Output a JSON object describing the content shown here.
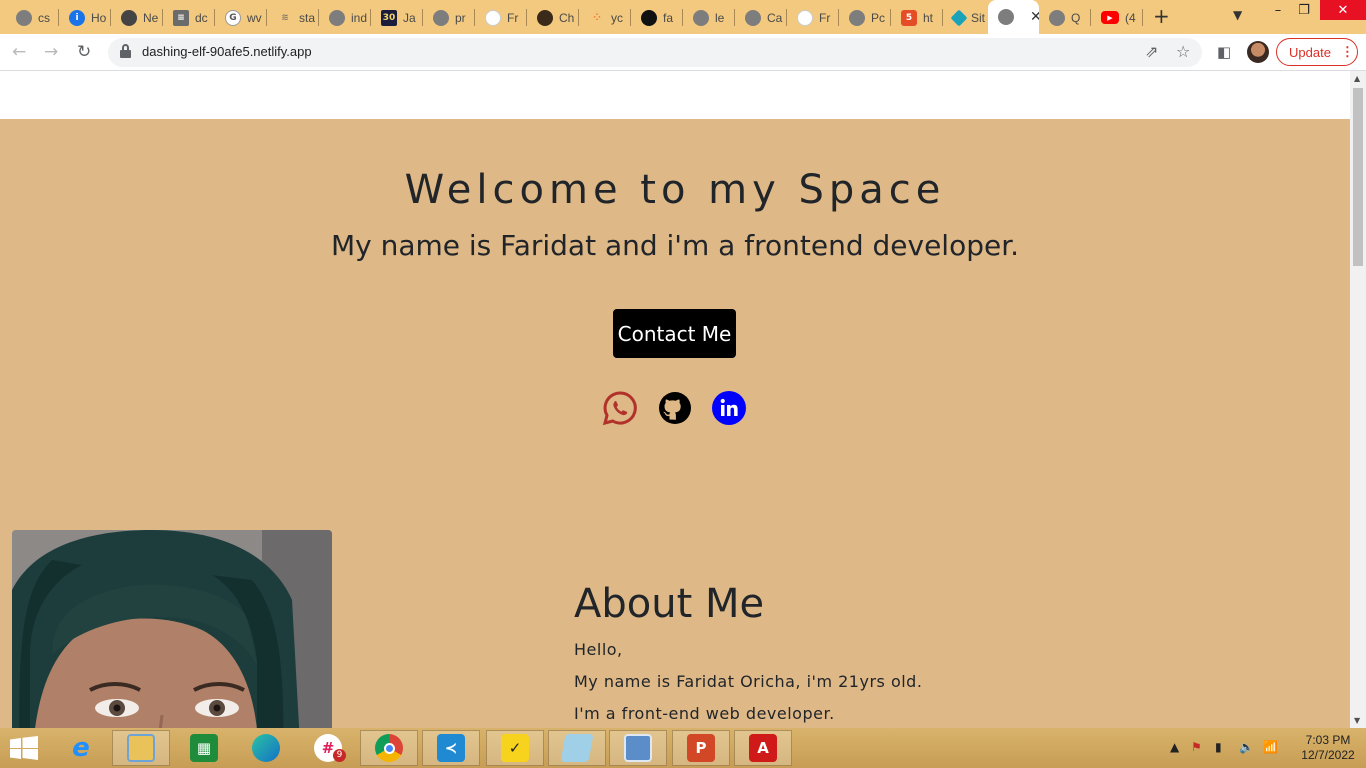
{
  "browser": {
    "tabs": [
      {
        "label": "cs",
        "icon": "globe-icon"
      },
      {
        "label": "Ho",
        "icon": "info-icon"
      },
      {
        "label": "Ne",
        "icon": "globe-icon"
      },
      {
        "label": "dc",
        "icon": "document-icon"
      },
      {
        "label": "wv",
        "icon": "google-icon"
      },
      {
        "label": "sta",
        "icon": "stack-icon"
      },
      {
        "label": "ind",
        "icon": "globe-icon"
      },
      {
        "label": "Ja",
        "icon": "js30-icon"
      },
      {
        "label": "pr",
        "icon": "globe-icon"
      },
      {
        "label": "Fr",
        "icon": "freecodecamp-icon"
      },
      {
        "label": "Ch",
        "icon": "avatar-icon"
      },
      {
        "label": "yc",
        "icon": "ycombinator-icon"
      },
      {
        "label": "fa",
        "icon": "github-icon"
      },
      {
        "label": "le",
        "icon": "globe-icon"
      },
      {
        "label": "Ca",
        "icon": "globe-icon"
      },
      {
        "label": "Fr",
        "icon": "freecodecamp-icon"
      },
      {
        "label": "Pc",
        "icon": "globe-icon"
      },
      {
        "label": "ht",
        "icon": "html5-icon"
      },
      {
        "label": "Sit",
        "icon": "diamond-icon"
      },
      {
        "label": "",
        "icon": "globe-icon",
        "active": true
      },
      {
        "label": "Q",
        "icon": "globe-icon"
      },
      {
        "label": "(4",
        "icon": "youtube-icon"
      }
    ],
    "url": "dashing-elf-90afe5.netlify.app",
    "update_label": "Update"
  },
  "page": {
    "hero_title": "Welcome to my Space",
    "hero_subtitle": "My name is Faridat and i'm a frontend developer.",
    "contact_button": "Contact Me",
    "socials": [
      "whatsapp-icon",
      "github-icon",
      "linkedin-icon"
    ],
    "about": {
      "title": "About Me",
      "lines": [
        "Hello,",
        "My name is Faridat Oricha, i'm 21yrs old.",
        "I'm a front-end web developer."
      ]
    }
  },
  "taskbar": {
    "apps": [
      "internet-explorer-icon",
      "file-explorer-icon",
      "store-icon",
      "edge-icon",
      "slack-icon",
      "chrome-icon",
      "vscode-icon",
      "sticky-notes-icon",
      "notepad-icon",
      "photos-icon",
      "powerpoint-icon",
      "acrobat-icon"
    ],
    "slack_badge": "9",
    "time": "7:03 PM",
    "date": "12/7/2022"
  },
  "colors": {
    "hero_bg": "#deb887",
    "tabstrip_bg": "#f2c97e",
    "whatsapp": "#b0322b",
    "linkedin": "#0000ff",
    "update_red": "#d93025"
  }
}
